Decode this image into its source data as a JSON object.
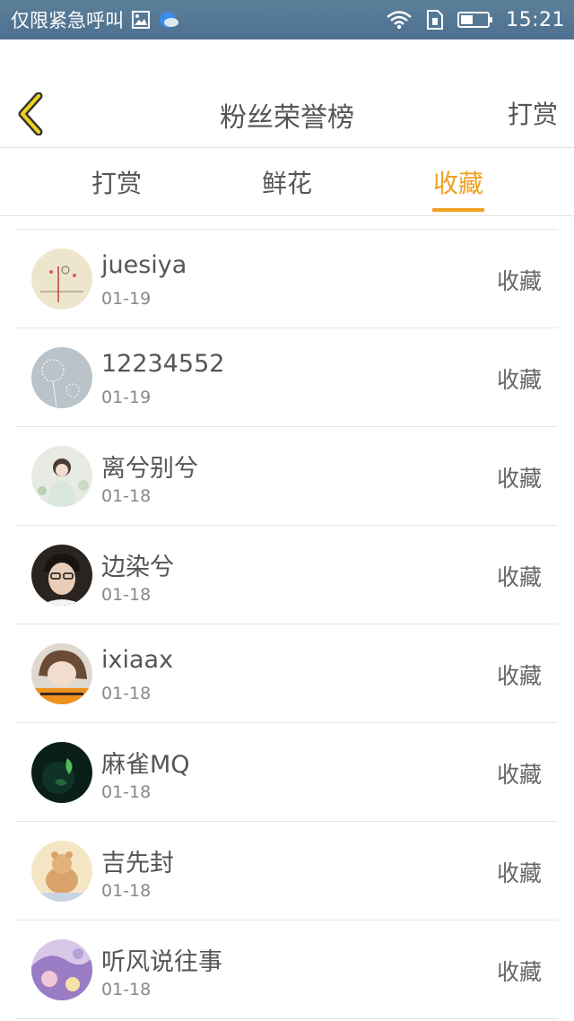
{
  "status_bar": {
    "carrier_text": "仅限紧急呼叫",
    "time": "15:21",
    "icons": [
      "gallery-icon",
      "weather-icon",
      "wifi-icon",
      "sim-icon",
      "battery-icon"
    ]
  },
  "header": {
    "title": "粉丝荣誉榜",
    "right_action": "打赏"
  },
  "tabs": [
    {
      "label": "打赏",
      "active": false
    },
    {
      "label": "鲜花",
      "active": false
    },
    {
      "label": "收藏",
      "active": true
    }
  ],
  "colors": {
    "accent": "#f0a020",
    "statusbar": "#567a95",
    "text": "#555555"
  },
  "fans": [
    {
      "name": "juesiya",
      "date": "01-19",
      "action": "收藏"
    },
    {
      "name": "12234552",
      "date": "01-19",
      "action": "收藏"
    },
    {
      "name": "离兮别兮",
      "date": "01-18",
      "action": "收藏"
    },
    {
      "name": "边染兮",
      "date": "01-18",
      "action": "收藏"
    },
    {
      "name": "ixiaax",
      "date": "01-18",
      "action": "收藏"
    },
    {
      "name": "麻雀MQ",
      "date": "01-18",
      "action": "收藏"
    },
    {
      "name": "吉先封",
      "date": "01-18",
      "action": "收藏"
    },
    {
      "name": "听风说往事",
      "date": "01-18",
      "action": "收藏"
    }
  ]
}
